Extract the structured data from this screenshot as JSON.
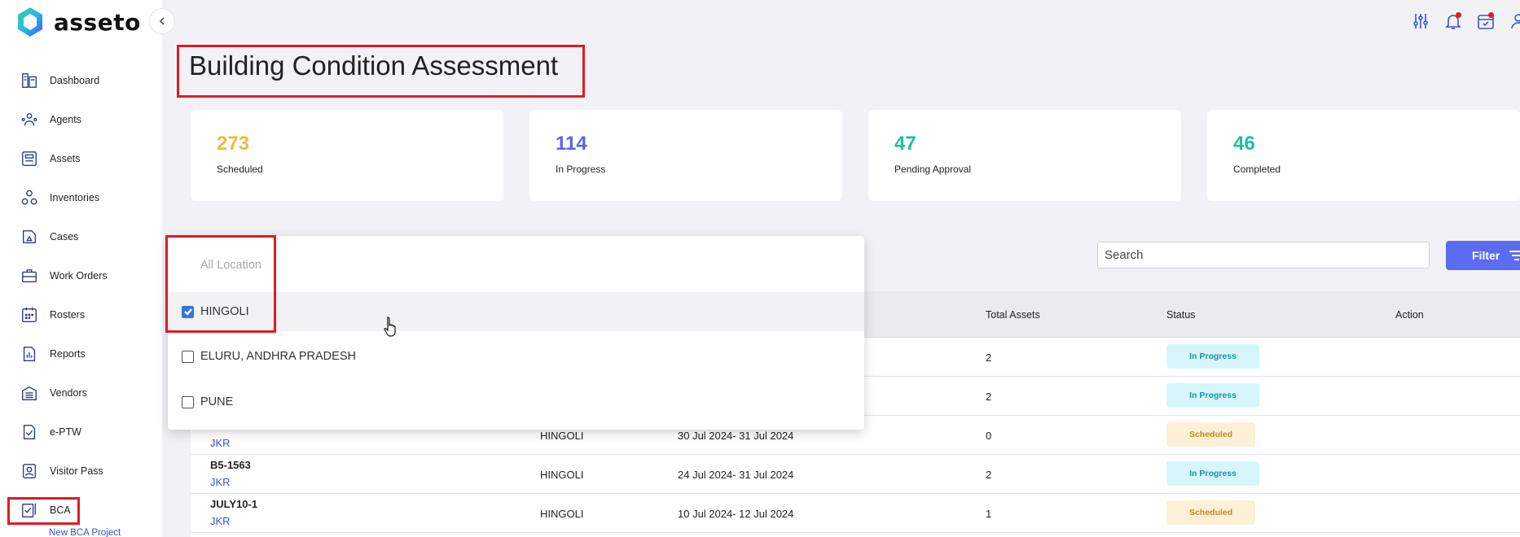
{
  "app": {
    "name": "asseto"
  },
  "sidebar": {
    "items": [
      {
        "label": "Dashboard",
        "icon": "dashboard-icon"
      },
      {
        "label": "Agents",
        "icon": "agents-icon"
      },
      {
        "label": "Assets",
        "icon": "assets-icon"
      },
      {
        "label": "Inventories",
        "icon": "inventories-icon"
      },
      {
        "label": "Cases",
        "icon": "cases-icon"
      },
      {
        "label": "Work Orders",
        "icon": "work-orders-icon"
      },
      {
        "label": "Rosters",
        "icon": "rosters-icon"
      },
      {
        "label": "Reports",
        "icon": "reports-icon"
      },
      {
        "label": "Vendors",
        "icon": "vendors-icon"
      },
      {
        "label": "e-PTW",
        "icon": "eptw-icon"
      },
      {
        "label": "Visitor Pass",
        "icon": "visitor-pass-icon"
      },
      {
        "label": "BCA",
        "icon": "bca-icon"
      }
    ],
    "sub_item": "New BCA Project"
  },
  "header": {
    "icons": [
      "settings-sliders-icon",
      "notifications-bell-icon",
      "calendar-check-icon",
      "user-profile-icon"
    ]
  },
  "page": {
    "title": "Building Condition Assessment"
  },
  "stats": [
    {
      "value": "273",
      "label": "Scheduled",
      "color": "#f5b83c"
    },
    {
      "value": "114",
      "label": "In Progress",
      "color": "#5a63e6"
    },
    {
      "value": "47",
      "label": "Pending Approval",
      "color": "#1dbf9e"
    },
    {
      "value": "46",
      "label": "Completed",
      "color": "#1dbf9e"
    }
  ],
  "search": {
    "placeholder": "Search"
  },
  "filter": {
    "label": "Filter"
  },
  "location_dropdown": {
    "placeholder": "All Location",
    "options": [
      {
        "label": "HINGOLI",
        "checked": true
      },
      {
        "label": "ELURU, ANDHRA PRADESH",
        "checked": false
      },
      {
        "label": "PUNE",
        "checked": false
      }
    ]
  },
  "table": {
    "columns": [
      "Total Assets",
      "Status",
      "Action"
    ],
    "rows": [
      {
        "id": "",
        "org": "",
        "location": "",
        "dates": "",
        "total_assets": "2",
        "status": "In Progress"
      },
      {
        "id": "",
        "org": "",
        "location": "",
        "dates": "",
        "total_assets": "2",
        "status": "In Progress"
      },
      {
        "id": "",
        "org": "JKR",
        "location": "HINGOLI",
        "dates": "30 Jul 2024- 31 Jul 2024",
        "total_assets": "0",
        "status": "Scheduled"
      },
      {
        "id": "B5-1563",
        "org": "JKR",
        "location": "HINGOLI",
        "dates": "24 Jul 2024- 31 Jul 2024",
        "total_assets": "2",
        "status": "In Progress"
      },
      {
        "id": "JULY10-1",
        "org": "JKR",
        "location": "HINGOLI",
        "dates": "10 Jul 2024- 12 Jul 2024",
        "total_assets": "1",
        "status": "Scheduled"
      }
    ]
  }
}
